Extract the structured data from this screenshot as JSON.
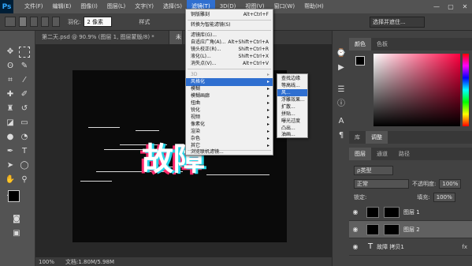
{
  "app": {
    "logo": "Ps"
  },
  "menubar": {
    "items": [
      "文件(F)",
      "编辑(E)",
      "图像(I)",
      "图层(L)",
      "文字(Y)",
      "选择(S)",
      "滤镜(T)",
      "3D(D)",
      "视图(V)",
      "窗口(W)",
      "帮助(H)"
    ],
    "active_index": 6,
    "window_controls": [
      "—",
      "▢",
      "✕"
    ]
  },
  "options": {
    "feather_label": "羽化:",
    "feather_value": "2 像素",
    "style_label": "样式",
    "workspace_select": "选择并遮住..."
  },
  "tabs": [
    {
      "label": "第二天.psd @ 90.9% (图层 1, 图层蒙版/8) *",
      "active": false
    },
    {
      "label": "未",
      "active": true
    }
  ],
  "filter_menu": {
    "items": [
      {
        "label": "铜版雕刻",
        "shortcut": "Alt+Ctrl+F"
      },
      {
        "sep": true
      },
      {
        "label": "转换为智能滤镜(S)"
      },
      {
        "sep": true
      },
      {
        "label": "滤镜库(G)..."
      },
      {
        "label": "自适应广角(A)...",
        "shortcut": "Alt+Shift+Ctrl+A"
      },
      {
        "label": "镜头校正(R)...",
        "shortcut": "Shift+Ctrl+R"
      },
      {
        "label": "液化(L)...",
        "shortcut": "Shift+Ctrl+X"
      },
      {
        "label": "消失点(V)...",
        "shortcut": "Alt+Ctrl+V"
      },
      {
        "sep": true
      },
      {
        "label": "3D",
        "submenu": true,
        "dim": true
      },
      {
        "label": "风格化",
        "submenu": true,
        "highlighted": true
      },
      {
        "label": "模糊",
        "submenu": true
      },
      {
        "label": "模糊画廊",
        "submenu": true
      },
      {
        "label": "扭曲",
        "submenu": true
      },
      {
        "label": "锐化",
        "submenu": true
      },
      {
        "label": "视频",
        "submenu": true
      },
      {
        "label": "像素化",
        "submenu": true
      },
      {
        "label": "渲染",
        "submenu": true
      },
      {
        "label": "杂色",
        "submenu": true
      },
      {
        "label": "其它",
        "submenu": true
      },
      {
        "sep": true
      },
      {
        "label": "浏览联机滤镜..."
      }
    ]
  },
  "stylize_submenu": {
    "items": [
      {
        "label": "查找边缘"
      },
      {
        "label": "等高线..."
      },
      {
        "label": "风...",
        "highlighted": true
      },
      {
        "label": "浮雕效果..."
      },
      {
        "label": "扩散..."
      },
      {
        "label": "拼贴..."
      },
      {
        "label": "曝光过度"
      },
      {
        "label": "凸出..."
      },
      {
        "label": "油画..."
      }
    ]
  },
  "canvas": {
    "text": "故障"
  },
  "status": {
    "zoom": "100%",
    "doc": "文档:1.80M/5.98M"
  },
  "color_panel": {
    "tabs": [
      "颜色",
      "色板"
    ],
    "hue_color": "#ff0040"
  },
  "lib_panel": {
    "tabs": [
      "库",
      "调整"
    ]
  },
  "layers_panel": {
    "tabs": [
      "图层",
      "通道",
      "路径"
    ],
    "kind_filter": "ρ类型",
    "blend_mode": "正常",
    "opacity_label": "不透明度:",
    "opacity_value": "100%",
    "lock_label": "锁定:",
    "fill_label": "填充:",
    "fill_value": "100%",
    "layers": [
      {
        "name": "图层 1",
        "type": "masked",
        "selected": false
      },
      {
        "name": "图层 2",
        "type": "masked",
        "selected": true
      },
      {
        "name": "故障 拷贝1",
        "type": "text",
        "selected": false,
        "fx": "fx"
      }
    ]
  }
}
